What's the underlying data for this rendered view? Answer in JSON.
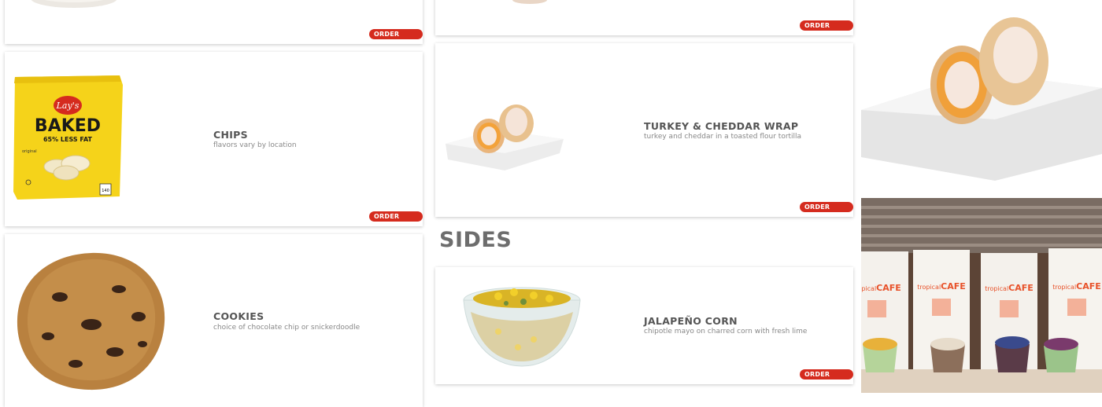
{
  "left_column": {
    "cards": [
      {
        "title": "",
        "description": "",
        "order_label": "ORDER NOW"
      },
      {
        "title": "CHIPS",
        "description": "flavors vary by location",
        "order_label": "ORDER NOW",
        "image_icon": "chips-bag-image",
        "bag_brand": "Lay's",
        "bag_name": "BAKED",
        "bag_tag": "65% LESS FAT",
        "bag_variant": "original",
        "bag_cal": "140"
      },
      {
        "title": "COOKIES",
        "description": "choice of chocolate chip or snickerdoodle",
        "order_label": "",
        "image_icon": "cookie-image"
      }
    ]
  },
  "middle_column": {
    "cards": [
      {
        "title": "",
        "description": "",
        "order_label": "ORDER NOW"
      },
      {
        "title": "TURKEY & CHEDDAR WRAP",
        "description": "turkey and cheddar in a toasted flour tortilla",
        "order_label": "ORDER NOW",
        "image_icon": "wrap-image"
      }
    ],
    "section_title": "SIDES",
    "side_cards": [
      {
        "title": "JALAPEÑO CORN",
        "description": "chipotle mayo on charred corn with fresh lime",
        "order_label": "ORDER NOW",
        "image_icon": "corn-bowl-image"
      }
    ]
  },
  "right_column": {
    "photo_top": "wrap-photo",
    "photo_bottom": "cafe-bags-photo",
    "bag_brand_prefix": "tropical",
    "bag_brand_suffix": "CAFE"
  },
  "colors": {
    "accent": "#d52b1e",
    "title": "#555555",
    "desc": "#888888"
  }
}
